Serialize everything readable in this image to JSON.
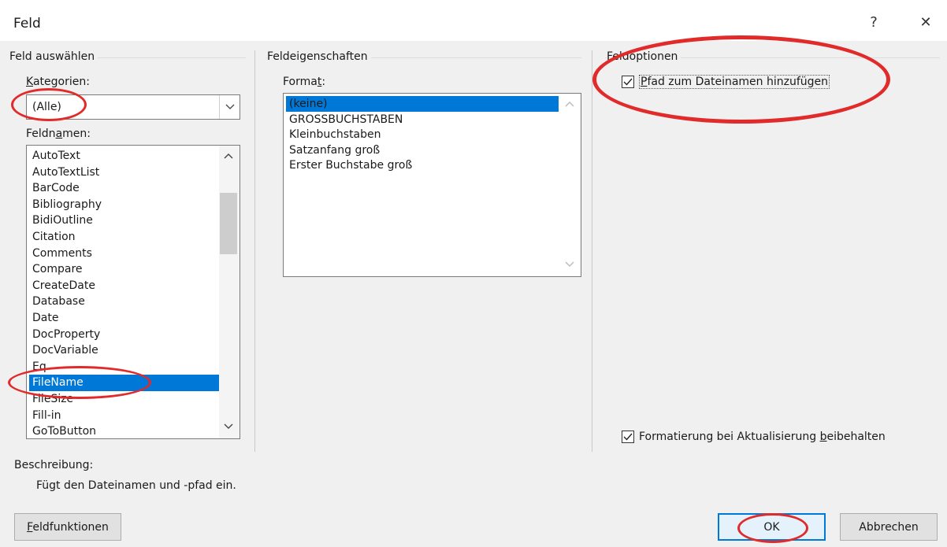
{
  "window": {
    "title": "Feld",
    "help_glyph": "?",
    "close_glyph": "✕"
  },
  "select_group": {
    "title": "Feld auswählen",
    "categories_label_pre": "",
    "categories_label_key": "K",
    "categories_label_post": "ategorien:",
    "categories_value": "(Alle)",
    "fieldnames_label_pre": "Feldn",
    "fieldnames_label_key": "a",
    "fieldnames_label_post": "men:",
    "fieldnames": [
      "AutoText",
      "AutoTextList",
      "BarCode",
      "Bibliography",
      "BidiOutline",
      "Citation",
      "Comments",
      "Compare",
      "CreateDate",
      "Database",
      "Date",
      "DocProperty",
      "DocVariable",
      "Eq",
      "FileName",
      "FileSize",
      "Fill-in",
      "GoToButton"
    ],
    "selected_fieldname": "FileName"
  },
  "properties_group": {
    "title": "Feldeigenschaften",
    "format_label_pre": "Forma",
    "format_label_key": "t",
    "format_label_post": ":",
    "formats": [
      "(keine)",
      "GROSSBUCHSTABEN",
      "Kleinbuchstaben",
      "Satzanfang groß",
      "Erster Buchstabe groß"
    ],
    "selected_format": "(keine)"
  },
  "options_group": {
    "title": "Feldoptionen",
    "add_path_key": "P",
    "add_path_rest": "fad zum Dateinamen hinzufügen",
    "add_path_checked": true,
    "keep_format_pre": "Formatierung bei Aktualisierung ",
    "keep_format_key": "b",
    "keep_format_post": "eibehalten",
    "keep_format_checked": true
  },
  "description": {
    "label": "Beschreibung:",
    "text": "Fügt den Dateinamen und -pfad ein."
  },
  "buttons": {
    "field_codes_key": "F",
    "field_codes_rest": "eldfunktionen",
    "ok": "OK",
    "cancel": "Abbrechen"
  },
  "annotation_color": "#e12a2a",
  "accent_color": "#0078d7"
}
